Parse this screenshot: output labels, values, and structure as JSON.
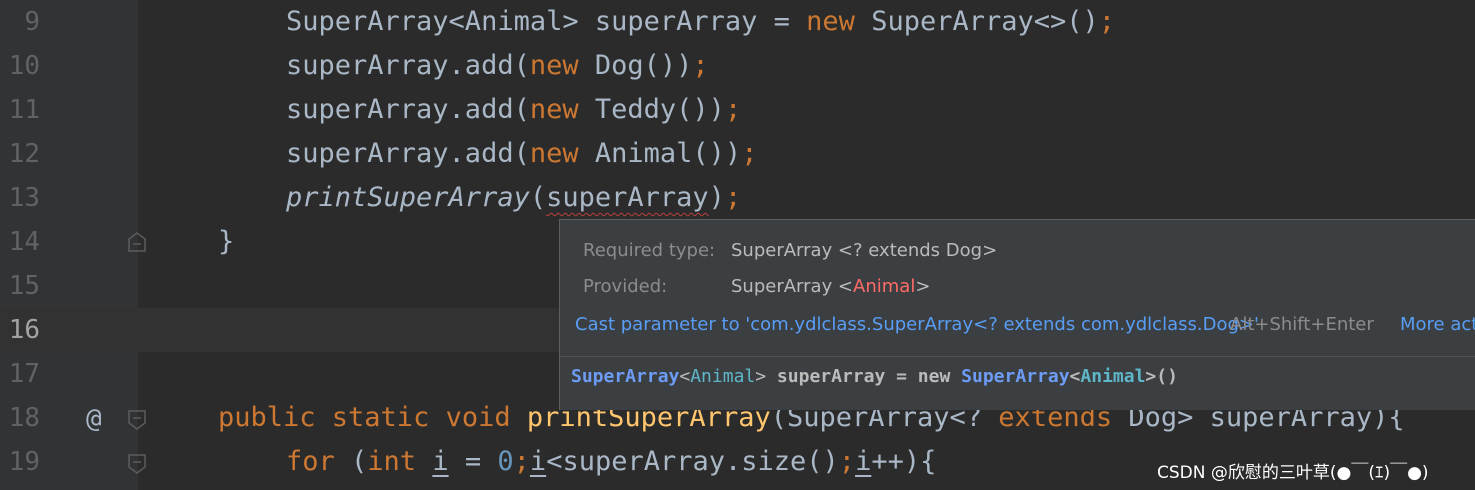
{
  "editor": {
    "lines": [
      {
        "number": "9"
      },
      {
        "number": "10"
      },
      {
        "number": "11"
      },
      {
        "number": "12"
      },
      {
        "number": "13"
      },
      {
        "number": "14"
      },
      {
        "number": "15"
      },
      {
        "number": "16"
      },
      {
        "number": "17"
      },
      {
        "number": "18"
      },
      {
        "number": "19"
      }
    ],
    "current_line": "16",
    "gutter_marker": "@",
    "colors": {
      "background": "#2b2b2b",
      "keyword": "#cc7832",
      "method": "#ffc66d",
      "number": "#6897bb",
      "text": "#a9b7c6",
      "error_underline": "#bc3f3c"
    }
  },
  "tooltip": {
    "required_label": "Required type:",
    "required_value": "SuperArray <? extends Dog>",
    "provided_label": "Provided:",
    "provided_prefix": "SuperArray <",
    "provided_mismatch": "Animal",
    "provided_suffix": ">",
    "action_label": "Cast parameter to 'com.ydlclass.SuperArray<? extends com.ydlclass.Dog>'",
    "action_shortcut": "Alt+Shift+Enter",
    "more_actions": "More act",
    "declaration": {
      "type": "SuperArray",
      "lt": "<",
      "type_arg": "Animal",
      "gt": ">",
      "rest": " superArray = new ",
      "type2": "SuperArray",
      "lt2": "<",
      "type_arg2": "Animal",
      "tail": ">()"
    }
  },
  "watermark": "CSDN @欣慰的三叶草(●￣(ｴ)￣●)"
}
